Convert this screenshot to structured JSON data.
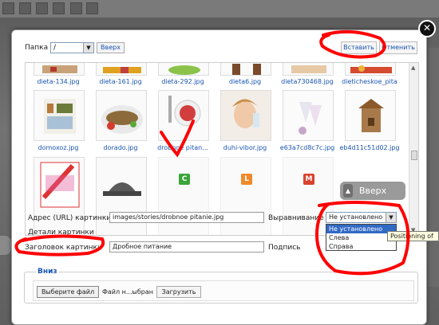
{
  "header": {
    "folder_label": "Папка",
    "folder_value": "/",
    "up_button": "Вверх",
    "insert_button": "Вставить",
    "cancel_button": "Отменить"
  },
  "thumbnails": [
    {
      "name": "dieta-134.jpg"
    },
    {
      "name": "dieta-161.jpg"
    },
    {
      "name": "dieta-292.jpg"
    },
    {
      "name": "dieta6.jpg"
    },
    {
      "name": "dieta730468.jpg"
    },
    {
      "name": "dieticheskoe_pita"
    },
    {
      "name": "domoxoz.jpg"
    },
    {
      "name": "dorado.jpg"
    },
    {
      "name": "drobnoe pitan..."
    },
    {
      "name": "duhi-vibor.jpg"
    },
    {
      "name": "e63a7cd8c7c.jpg"
    },
    {
      "name": "eb4d11c51d02.jpg"
    }
  ],
  "row3_badges": [
    {
      "letter": "C",
      "color": "#3aa53a"
    },
    {
      "letter": "L",
      "color": "#f08a2a"
    },
    {
      "letter": "M",
      "color": "#d9442e"
    }
  ],
  "overlay_up_button": "Вверх",
  "fields": {
    "url_label": "Адрес (URL) картинки",
    "url_value": "images/stories/drobnoe pitanie.jpg",
    "alignment_label": "Выравнивание",
    "alignment_value": "Не установлено",
    "alignment_options": [
      "Не установлено",
      "Слева",
      "Справа"
    ],
    "details_label": "Детали картинки",
    "title_label": "Заголовок картинки",
    "title_value": "Дробное питание",
    "caption_label": "Подпись",
    "tooltip": "Positioning of"
  },
  "upload": {
    "legend": "Вниз",
    "choose_button": "Выберите файл",
    "file_status": "Файл н...ыбран",
    "upload_button": "Загрузить"
  },
  "colors": {
    "link": "#1a55b0",
    "annotation": "#ff0000",
    "selected_option": "#316ac5"
  }
}
